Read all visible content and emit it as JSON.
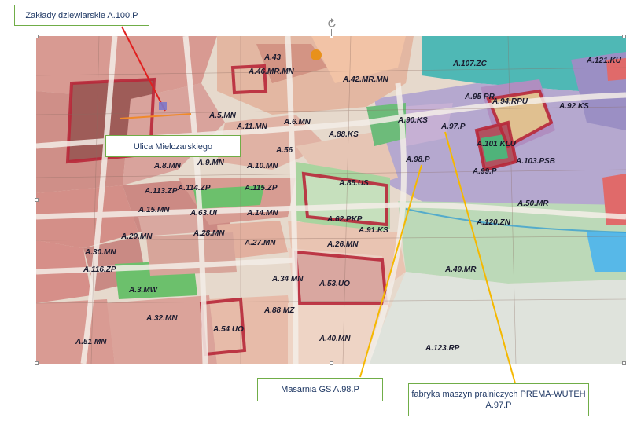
{
  "callouts": {
    "zaklady": "Zakłady dziewiarskie A.100.P",
    "ulica": "Ulica Mielczarskiego",
    "masarnia": "Masarnia GS A.98.P",
    "fabryka_line1": "fabryka maszyn pralniczych PREMA-WUTEH",
    "fabryka_line2": "A.97.P"
  },
  "map_labels": [
    "A.43",
    "A.46.MR.MN",
    "A.42.MR.MN",
    "A.107.ZC",
    "A.121.KU",
    "A.94.RPU",
    "A.95 PR",
    "A.92 KS",
    "A.101 KLU",
    "A.103.PSB",
    "A.97.P",
    "A.98.P",
    "A.99.P",
    "A.90.KS",
    "A.88.KS",
    "A.6.MN",
    "A.5.MN",
    "A.11.MN",
    "A.85.US",
    "A.115.ZP",
    "A.114.ZP",
    "A.113.ZP",
    "A.10.MN",
    "A.8.MN",
    "A.14.MN",
    "A.15.MN",
    "A.62.PKP",
    "A.91.KS",
    "A.50.MR",
    "A.120.ZN",
    "A.26.MN",
    "A.27.MN",
    "A.28.MN",
    "A.29.MN",
    "A.30.MN",
    "A.116.ZP",
    "A.3.MW",
    "A.32.MN",
    "A.53.UO",
    "A.49.MR",
    "A.34 MN",
    "A.88 MZ",
    "A.54 UO",
    "A.40.MN",
    "A.123.RP",
    "A.51 MN",
    "A.63.UI",
    "A.9.MN",
    "A.56"
  ],
  "colors": {
    "callout_border": "#70ad47",
    "callout_text": "#1f3864",
    "arrow_red": "#e02020",
    "arrow_yellow": "#f5b800",
    "street_line": "#f08a2a"
  }
}
